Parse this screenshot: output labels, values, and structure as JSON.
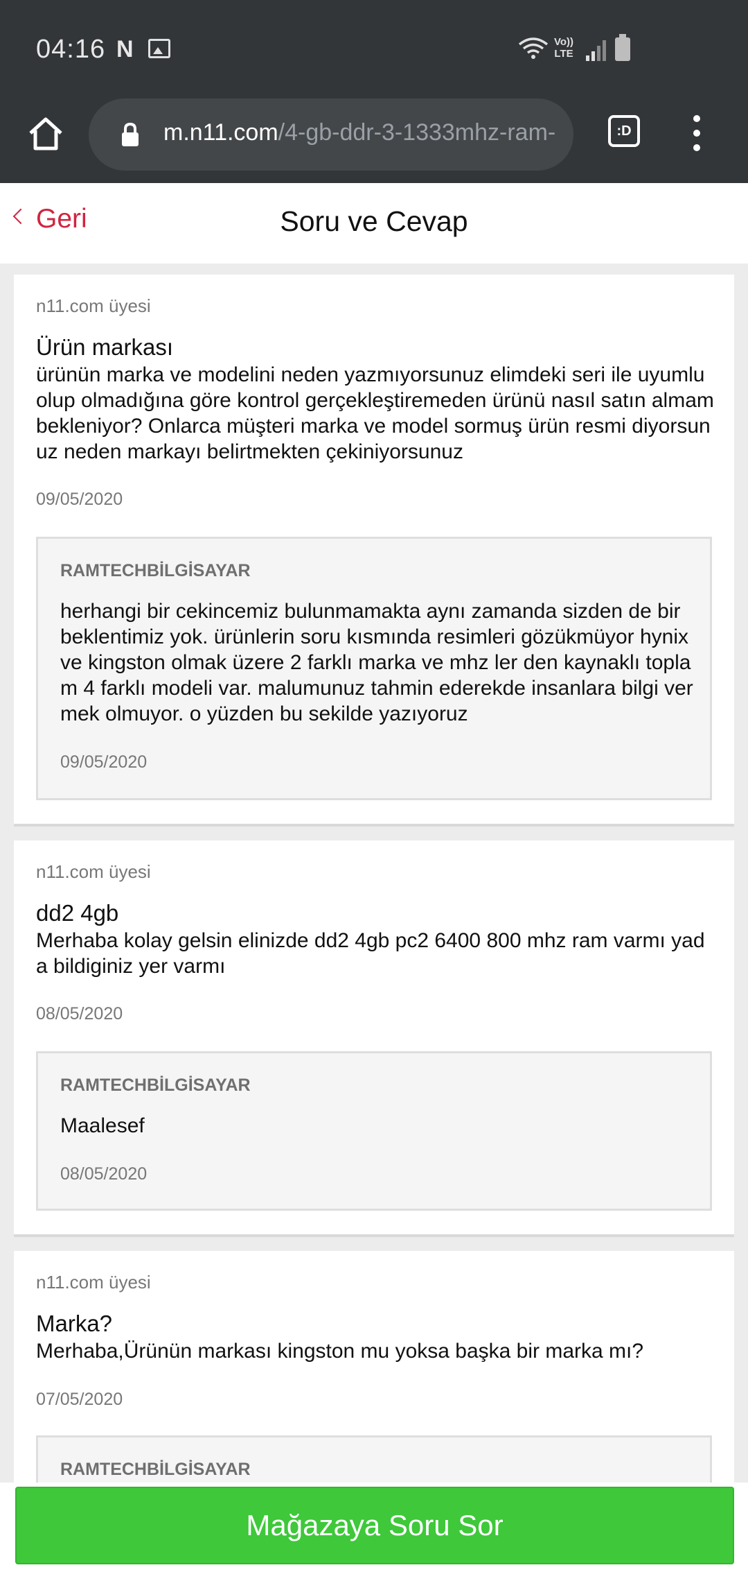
{
  "status_bar": {
    "time": "04:16",
    "notification_letter": "N",
    "lte_label_top": "Vo))",
    "lte_label_bottom": "LTE"
  },
  "browser": {
    "url_domain": "m.n11.com",
    "url_path": "/4-gb-ddr-3-1333mhz-ram-",
    "tabs_label": ":D"
  },
  "header": {
    "back_label": "Geri",
    "title": "Soru ve Cevap"
  },
  "questions": [
    {
      "author": "n11.com üyesi",
      "title": "Ürün markası",
      "body": "ürünün marka ve modelini neden yazmıyorsunuz elimdeki seri ile uyumlu olup olmadığına göre kontrol gerçekleştiremeden ürünü nasıl satın almam bekleniyor? Onlarca müşteri marka ve model sormuş ürün resmi diyorsunuz neden markayı belirtmekten çekiniyorsunuz",
      "date": "09/05/2020",
      "answer": {
        "seller": "RAMTECHBİLGİSAYAR",
        "body": "herhangi bir cekincemiz bulunmamakta aynı zamanda sizden de bir beklentimiz yok. ürünlerin soru kısmında resimleri gözükmüyor hynix ve kingston olmak üzere 2 farklı marka ve mhz ler den kaynaklı toplam 4 farklı modeli var. malumunuz tahmin ederekde insanlara bilgi vermek olmuyor. o yüzden bu sekilde yazıyoruz",
        "date": "09/05/2020"
      }
    },
    {
      "author": "n11.com üyesi",
      "title": "dd2 4gb",
      "body": "Merhaba kolay gelsin elinizde dd2 4gb pc2 6400 800 mhz ram varmı yada bildiginiz yer varmı",
      "date": "08/05/2020",
      "answer": {
        "seller": "RAMTECHBİLGİSAYAR",
        "body": "Maalesef",
        "date": "08/05/2020"
      }
    },
    {
      "author": "n11.com üyesi",
      "title": "Marka?",
      "body": "Merhaba,Ürünün markası kingston mu yoksa başka bir marka mı?",
      "date": "07/05/2020",
      "answer": {
        "seller": "RAMTECHBİLGİSAYAR"
      }
    }
  ],
  "cta": {
    "label": "Mağazaya Soru Sor"
  },
  "colors": {
    "accent_red": "#d0253f",
    "cta_green": "#3ec83a",
    "chrome_dark": "#333639"
  }
}
